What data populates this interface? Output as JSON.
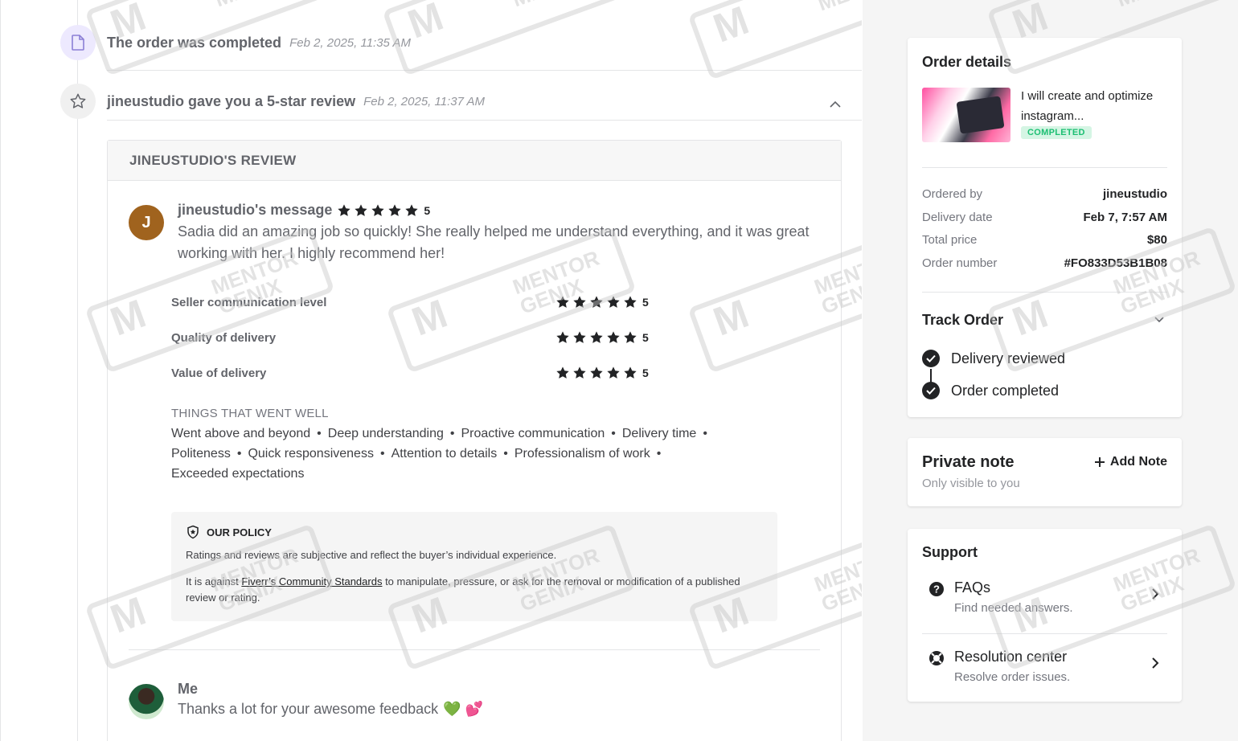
{
  "timeline": {
    "completed": {
      "text": "The order was completed",
      "time": "Feb 2, 2025, 11:35 AM"
    },
    "review": {
      "text": "jineustudio gave you a 5-star review",
      "time": "Feb 2, 2025, 11:37 AM"
    }
  },
  "review": {
    "header": "JINEUSTUDIO'S REVIEW",
    "avatar_letter": "J",
    "title": "jineustudio's message",
    "overall_rating": "5",
    "message": "Sadia did an amazing job so quickly! She really helped me understand everything, and it was great working with her. I highly recommend her!",
    "criteria": [
      {
        "label": "Seller communication level",
        "rating": "5"
      },
      {
        "label": "Quality of delivery",
        "rating": "5"
      },
      {
        "label": "Value of delivery",
        "rating": "5"
      }
    ],
    "things_title": "THINGS THAT WENT WELL",
    "things": [
      "Went above and beyond",
      "Deep understanding",
      "Proactive communication",
      "Delivery time",
      "Politeness",
      "Quick responsiveness",
      "Attention to details",
      "Professionalism of work",
      "Exceeded expectations"
    ],
    "policy": {
      "title": "OUR POLICY",
      "line1": "Ratings and reviews are subjective and reflect the buyer’s individual experience.",
      "line2_pre": "It is against ",
      "line2_link": "Fiverr’s Community Standards",
      "line2_post": " to manipulate, pressure, or ask for the removal or modification of a published review or rating."
    },
    "reply": {
      "name": "Me",
      "message": "Thanks a lot for your awesome feedback",
      "emoji": "💚 💕"
    }
  },
  "order_details": {
    "title": "Order details",
    "gig_title": "I will create and optimize instagram...",
    "status": "COMPLETED",
    "rows": [
      {
        "key": "Ordered by",
        "value": "jineustudio"
      },
      {
        "key": "Delivery date",
        "value": "Feb 7, 7:57 AM"
      },
      {
        "key": "Total price",
        "value": "$80"
      },
      {
        "key": "Order number",
        "value": "#FO833D53B1B08"
      }
    ],
    "track_title": "Track Order",
    "track": [
      "Delivery reviewed",
      "Order completed"
    ]
  },
  "private_note": {
    "title": "Private note",
    "subtitle": "Only visible to you",
    "add_label": "Add Note"
  },
  "support": {
    "title": "Support",
    "items": [
      {
        "title": "FAQs",
        "subtitle": "Find needed answers."
      },
      {
        "title": "Resolution center",
        "subtitle": "Resolve order issues."
      }
    ]
  },
  "watermark": {
    "line1": "MENTOR",
    "line2": "GENIX"
  },
  "colors": {
    "accent_green": "#1dbf73",
    "text_dark": "#222325",
    "text_muted": "#74767e",
    "timeline_icon_bg": "#ede9fe"
  }
}
